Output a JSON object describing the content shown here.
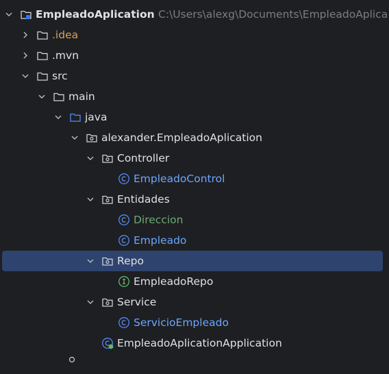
{
  "tree": {
    "root": {
      "label": "EmpleadoAplication",
      "path": "C:\\Users\\alexg\\Documents\\EmpleadoAplica"
    },
    "idea": {
      "label": ".idea"
    },
    "mvn": {
      "label": ".mvn"
    },
    "src": {
      "label": "src"
    },
    "main": {
      "label": "main"
    },
    "java": {
      "label": "java"
    },
    "pkg": {
      "label": "alexander.EmpleadoAplication"
    },
    "controller": {
      "label": "Controller"
    },
    "empleado_control": {
      "label": "EmpleadoControl"
    },
    "entidades": {
      "label": "Entidades"
    },
    "direccion": {
      "label": "Direccion"
    },
    "empleado": {
      "label": "Empleado"
    },
    "repo": {
      "label": "Repo"
    },
    "empleado_repo": {
      "label": "EmpleadoRepo"
    },
    "service": {
      "label": "Service"
    },
    "servicio_empleado": {
      "label": "ServicioEmpleado"
    },
    "app": {
      "label": "EmpleadoAplicationApplication"
    }
  },
  "colors": {
    "background": "#1e1f22",
    "selection": "#2e436e",
    "text": "#dfe1e5",
    "path": "#7a7e85",
    "class_blue": "#6aa7ff",
    "class_green": "#6aab73",
    "excluded_orange": "#d6a15e"
  }
}
